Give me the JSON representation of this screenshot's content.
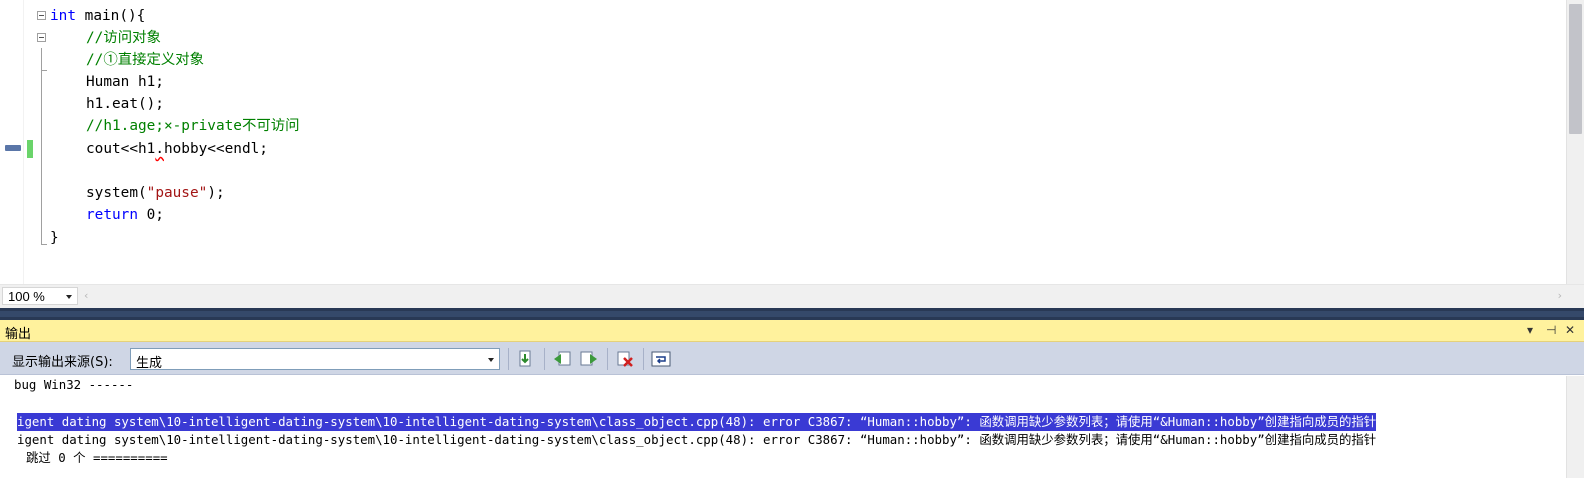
{
  "editor": {
    "code_lines": {
      "l1_kw": "int",
      "l1_rest": " main(){",
      "l2": "//访问对象",
      "l3": "//①直接定义对象",
      "l4": "Human h1;",
      "l5": "h1.eat();",
      "l6": "//h1.age;×-private不可访问",
      "l7_pre": "cout<<h1",
      "l7_squig": ".",
      "l7_post": "hobby<<endl;",
      "l9_pre": "system(",
      "l9_str": "\"pause\"",
      "l9_post": ");",
      "l10_kw": "return",
      "l10_rest": " 0;",
      "l11": "}"
    },
    "zoom": "100 %",
    "colors": {
      "keyword": "#0000ff",
      "comment": "#008000",
      "string": "#a31515",
      "change_bar": "#6ad46a"
    }
  },
  "output": {
    "title": "输出",
    "title_buttons": [
      "▾",
      "⊣",
      "✕"
    ],
    "source_label": "显示输出来源(S):",
    "source_value": "生成",
    "toolbar_icons": [
      "goto-error-icon",
      "prev-message-icon",
      "next-message-icon",
      "clear-all-icon",
      "word-wrap-icon"
    ],
    "lines": [
      "bug Win32 ------",
      "",
      "igent dating system\\10-intelligent-dating-system\\10-intelligent-dating-system\\class_object.cpp(48): error C3867: “Human::hobby”: 函数调用缺少参数列表；请使用“&Human::hobby”创建指向成员的指针",
      "igent dating system\\10-intelligent-dating-system\\10-intelligent-dating-system\\class_object.cpp(48): error C3867: “Human::hobby”: 函数调用缺少参数列表；请使用“&Human::hobby”创建指向成员的指针",
      "跳过 0 个 =========="
    ],
    "colors": {
      "title_bg": "#fff29d",
      "toolbar_bg": "#cfd6e5",
      "selection": "#3a3ad4"
    }
  }
}
